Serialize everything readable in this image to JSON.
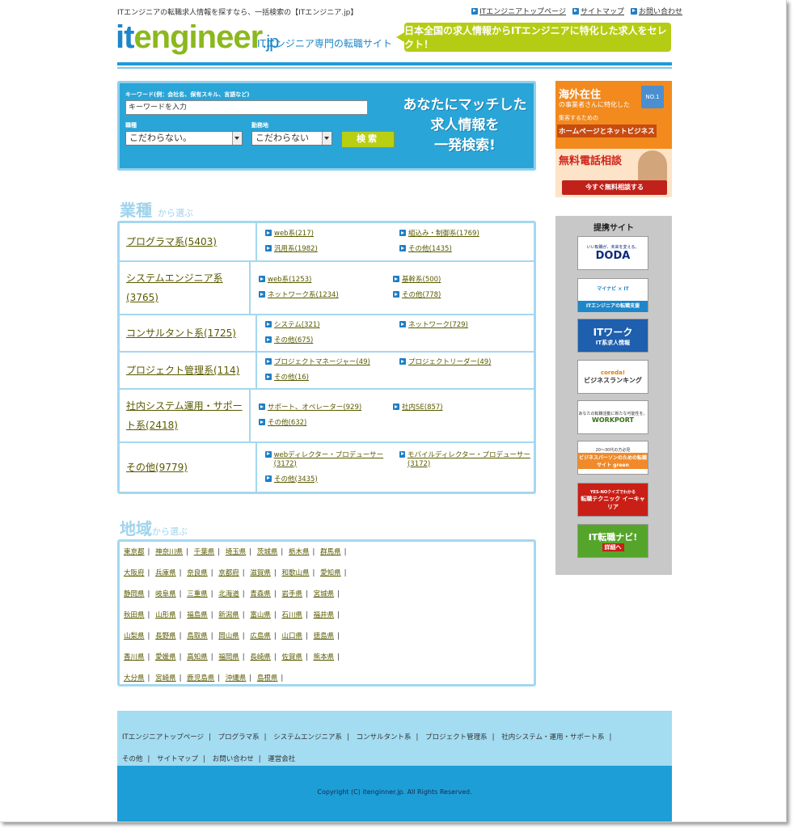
{
  "header": {
    "tagline": "ITエンジニアの転職求人情報を探すなら、一括検索の【ITエンジニア.jp】",
    "top_links": [
      "ITエンジニアトップページ",
      "サイトマップ",
      "お問い合わせ"
    ],
    "logo_it": "it",
    "logo_engineer": "engineer",
    "logo_jp": ".jp",
    "logo_sub": "ITエンジニア専門の転職サイト",
    "banner": "日本全国の求人情報からITエンジニアに特化した求人をセレクト！",
    "brand_color": "#1e86c9",
    "accent_color": "#b5cc14"
  },
  "search": {
    "keyword_label": "キーワード(例：会社名、保有スキル、言語など)",
    "keyword_value": "キーワードを入力",
    "job_label": "職種",
    "job_value": "こだわらない。",
    "area_label": "勤務地",
    "area_value": "こだわらない",
    "button": "検索",
    "promo_line1": "あなたにマッチした",
    "promo_line2": "求人情報を",
    "promo_line3": "一発検索!"
  },
  "category": {
    "title": "業種",
    "title_sub": "から選ぶ",
    "rows": [
      {
        "name": "プログラマ系(5403)",
        "links": [
          "web系(217)",
          "組込み・制御系(1769)",
          "汎用系(1982)",
          "その他(1435)"
        ]
      },
      {
        "name": "システムエンジニア系(3765)",
        "links": [
          "web系(1253)",
          "基幹系(500)",
          "ネットワーク系(1234)",
          "その他(778)"
        ]
      },
      {
        "name": "コンサルタント系(1725)",
        "links": [
          "システム(321)",
          "ネットワーク(729)",
          "その他(675)"
        ]
      },
      {
        "name": "プロジェクト管理系(114)",
        "links": [
          "プロジェクトマネージャー(49)",
          "プロジェクトリーダー(49)",
          "その他(16)"
        ]
      },
      {
        "name": "社内システム運用・サポート系(2418)",
        "links": [
          "サポート、オペレーター(929)",
          "社内SE(857)",
          "その他(632)"
        ]
      },
      {
        "name": "その他(9779)",
        "links": [
          "webディレクター・プロデューサー(3172)",
          "モバイルディレクター・プロデューサー(3172)",
          "その他(3435)"
        ]
      }
    ]
  },
  "region": {
    "title": "地域",
    "title_sub": "から選ぶ",
    "rows": [
      [
        "東京都",
        "神奈川県",
        "千葉県",
        "埼玉県",
        "茨城県",
        "栃木県",
        "群馬県"
      ],
      [
        "大阪府",
        "兵庫県",
        "奈良県",
        "京都府",
        "滋賀県",
        "和歌山県",
        "愛知県"
      ],
      [
        "静岡県",
        "岐阜県",
        "三重県",
        "北海道",
        "青森県",
        "岩手県",
        "宮城県"
      ],
      [
        "秋田県",
        "山形県",
        "福島県",
        "新潟県",
        "富山県",
        "石川県",
        "福井県"
      ],
      [
        "山梨県",
        "長野県",
        "鳥取県",
        "岡山県",
        "広島県",
        "山口県",
        "徳島県"
      ],
      [
        "香川県",
        "愛媛県",
        "高知県",
        "福岡県",
        "長崎県",
        "佐賀県",
        "熊本県"
      ],
      [
        "大分県",
        "宮崎県",
        "鹿児島県",
        "沖縄県",
        "島根県"
      ]
    ]
  },
  "side_ad": {
    "line1": "海外在住",
    "line2": "の事業者さんに特化した",
    "line3": "集客するための",
    "line4": "ホームページとネットビジネス",
    "line5": "無料電話相談",
    "button": "今すぐ無料相談する",
    "badge": "NO.1"
  },
  "partners": {
    "title": "提携サイト",
    "banners": [
      {
        "sub": "いい転職が、未来を変える。",
        "main": "DODA"
      },
      {
        "sub": "マイナビ × IT",
        "main": "ITエンジニアの転職支援"
      },
      {
        "sub": "ITワーク",
        "main": "IT系求人情報"
      },
      {
        "sub": "coreda!",
        "main": "ビジネスランキング"
      },
      {
        "sub": "あなたの転職活動に新たな可能性を。",
        "main": "WORKPORT"
      },
      {
        "sub": "20～30代の方必見",
        "main": "ビジネスパーソンのための転職サイト green"
      },
      {
        "sub": "YES-NOクイズでわかる",
        "main": "転職テクニック イーキャリア"
      },
      {
        "sub": "IT転職ナビ!",
        "main": "詳細へ"
      }
    ]
  },
  "footer": {
    "links_row1": [
      "ITエンジニアトップページ",
      "プログラマ系",
      "システムエンジニア系",
      "コンサルタント系",
      "プロジェクト管理系",
      "社内システム・運用・サポート系"
    ],
    "links_row2": [
      "その他",
      "サイトマップ",
      "お問い合わせ",
      "運営会社"
    ],
    "copyright": "Copyright (C) itenginner.jp. All Rights Reserved."
  }
}
